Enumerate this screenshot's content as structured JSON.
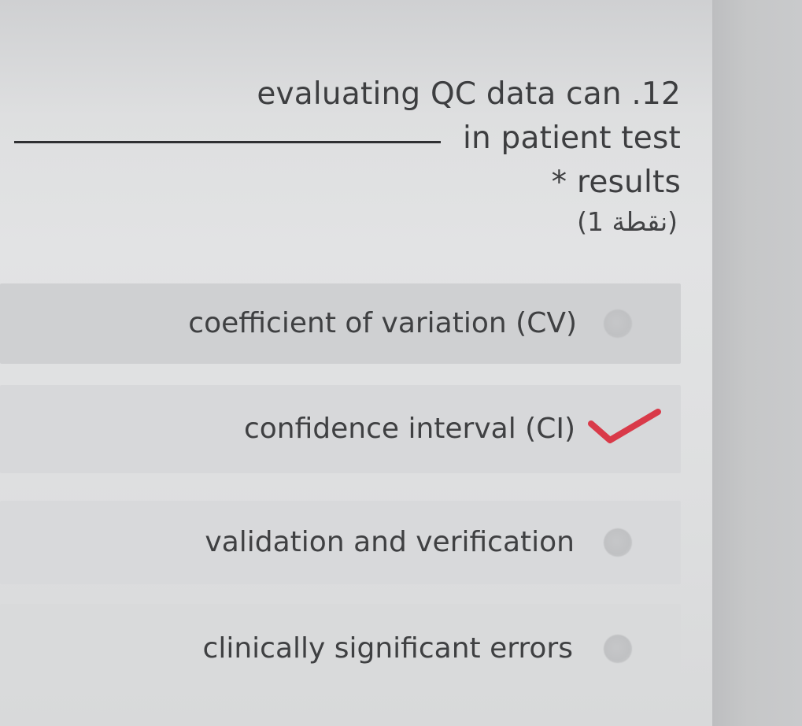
{
  "question": {
    "line1": "evaluating QC data can .12",
    "line2": "in patient test",
    "line3": "* results",
    "points": "(1 نقطة)"
  },
  "options": [
    {
      "label": "coefficient of variation (CV)",
      "status": "unselected"
    },
    {
      "label": "confidence interval (CI)",
      "status": "selected"
    },
    {
      "label": "validation and verification",
      "status": "unselected"
    },
    {
      "label": "clinically significant errors",
      "status": "unselected"
    }
  ],
  "colors": {
    "check": "#d93a49"
  },
  "icons": {
    "selected_mark": "check-mark-icon",
    "unselected_mark": "radio-button-icon"
  }
}
